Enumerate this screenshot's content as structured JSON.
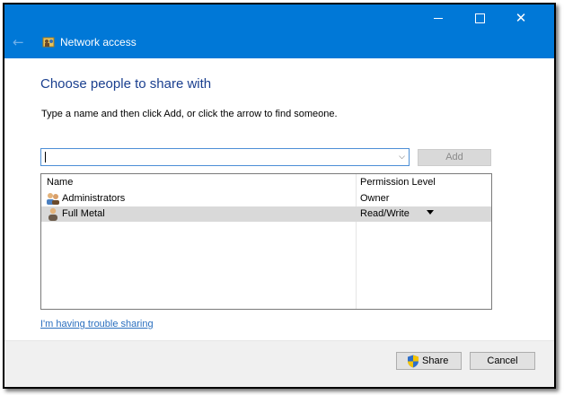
{
  "window": {
    "title": "Network access",
    "controls": {
      "minimize_icon": "minimize-icon",
      "maximize_icon": "maximize-icon",
      "close_icon": "close-icon"
    },
    "back_icon": "back-arrow-icon",
    "accent_color": "#0078d7"
  },
  "main": {
    "heading": "Choose people to share with",
    "instruction": "Type a name and then click Add, or click the arrow to find someone.",
    "name_input": {
      "value": "",
      "placeholder": ""
    },
    "add_button_label": "Add"
  },
  "share_list": {
    "columns": [
      "Name",
      "Permission Level"
    ],
    "rows": [
      {
        "name": "Administrators",
        "permission": "Owner",
        "icon": "group-users-icon"
      },
      {
        "name": "Full Metal",
        "permission": "Read/Write",
        "icon": "user-icon",
        "selected": true,
        "has_dropdown": true
      }
    ]
  },
  "trouble_link": "I'm having trouble sharing",
  "footer": {
    "share_label": "Share",
    "cancel_label": "Cancel"
  }
}
